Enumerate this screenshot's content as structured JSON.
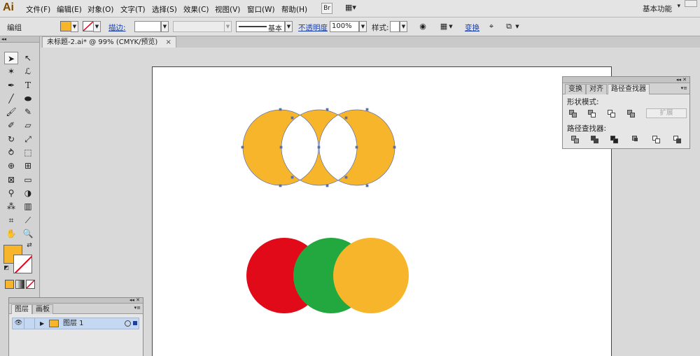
{
  "app": {
    "logo": "Ai"
  },
  "menu": [
    "文件(F)",
    "编辑(E)",
    "对象(O)",
    "文字(T)",
    "选择(S)",
    "效果(C)",
    "视图(V)",
    "窗口(W)",
    "帮助(H)"
  ],
  "menu_buttons": {
    "bridge": "Br",
    "arrange": "▦▾"
  },
  "workspace": {
    "label": "基本功能",
    "arrow": "▾"
  },
  "control_bar": {
    "mode_label": "编组",
    "fill_color": "#f7b52c",
    "stroke_label": "描边:",
    "stroke_style_label": "基本",
    "opacity_label": "不透明度",
    "opacity_value": "100%",
    "style_label": "样式:",
    "transform_label": "变换"
  },
  "document_tab": {
    "title": "未标题-2.ai* @ 99% (CMYK/预览)",
    "close": "×"
  },
  "toolbar": {
    "fill_color": "#f7b52c",
    "stroke_color": "none",
    "tools": [
      "selection-tool",
      "direct-selection-tool",
      "magic-wand-tool",
      "lasso-tool",
      "pen-tool",
      "type-tool",
      "line-tool",
      "ellipse-tool",
      "paintbrush-tool",
      "pencil-tool",
      "blob-brush-tool",
      "eraser-tool",
      "rotate-tool",
      "scale-tool",
      "warp-tool",
      "free-transform-tool",
      "shape-builder-tool",
      "perspective-grid-tool",
      "mesh-tool",
      "gradient-tool",
      "eyedropper-tool",
      "blend-tool",
      "symbol-sprayer-tool",
      "column-graph-tool",
      "artboard-tool",
      "slice-tool",
      "hand-tool",
      "zoom-tool"
    ]
  },
  "artwork": {
    "top_circles_color": "#f7b52c",
    "bottom_circles": [
      "#e10a18",
      "#22a83f",
      "#f7b52c"
    ]
  },
  "pathfinder_panel": {
    "tabs": [
      "变换",
      "对齐",
      "路径查找器"
    ],
    "active_tab": "路径查找器",
    "shape_modes_label": "形状模式:",
    "expand_label": "扩展",
    "pathfinders_label": "路径查找器:"
  },
  "layers_panel": {
    "tabs": [
      "图层",
      "画板"
    ],
    "active_tab": "图层",
    "layer_name": "图层 1"
  }
}
